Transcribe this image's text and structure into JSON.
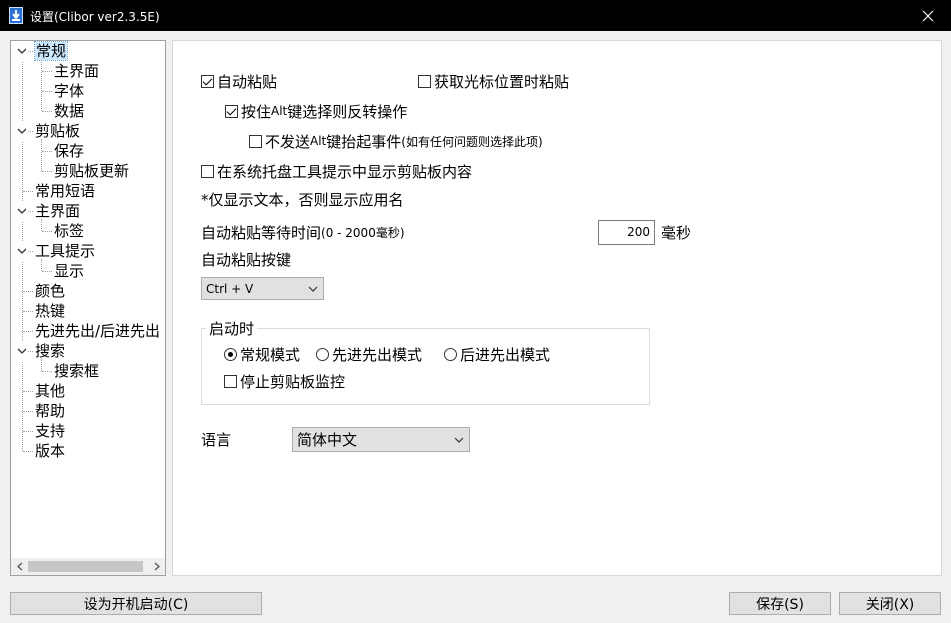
{
  "window": {
    "title": "设置(Clibor ver2.3.5E)"
  },
  "tree": {
    "items": [
      {
        "label": "常规",
        "level": 0,
        "expandable": true,
        "selected": true
      },
      {
        "label": "主界面",
        "level": 1
      },
      {
        "label": "字体",
        "level": 1
      },
      {
        "label": "数据",
        "level": 1
      },
      {
        "label": "剪贴板",
        "level": 0,
        "expandable": true
      },
      {
        "label": "保存",
        "level": 1
      },
      {
        "label": "剪贴板更新",
        "level": 1
      },
      {
        "label": "常用短语",
        "level": 0
      },
      {
        "label": "主界面",
        "level": 0,
        "expandable": true
      },
      {
        "label": "标签",
        "level": 1
      },
      {
        "label": "工具提示",
        "level": 0,
        "expandable": true
      },
      {
        "label": "显示",
        "level": 1
      },
      {
        "label": "颜色",
        "level": 0
      },
      {
        "label": "热键",
        "level": 0
      },
      {
        "label": "先进先出/后进先出",
        "level": 0
      },
      {
        "label": "搜索",
        "level": 0,
        "expandable": true
      },
      {
        "label": "搜索框",
        "level": 1
      },
      {
        "label": "其他",
        "level": 0
      },
      {
        "label": "帮助",
        "level": 0
      },
      {
        "label": "支持",
        "level": 0
      },
      {
        "label": "版本",
        "level": 0
      }
    ]
  },
  "general": {
    "auto_paste": {
      "label": "自动粘贴",
      "checked": true
    },
    "paste_on_cursor": {
      "label": "获取光标位置时粘贴",
      "checked": false
    },
    "alt_reverse": {
      "label_pre": "按住",
      "label_alt": "Alt",
      "label_post": "键选择则反转操作",
      "checked": true
    },
    "no_alt_up": {
      "label_pre": "不发送",
      "label_alt": "Alt",
      "label_mid": "键抬起事件",
      "label_post": "(如有任何问题则选择此项)",
      "checked": false
    },
    "tray_tooltip": {
      "label": "在系统托盘工具提示中显示剪贴板内容",
      "checked": false
    },
    "tray_note": "*仅显示文本，否则显示应用名",
    "wait_label": "自动粘贴等待时间",
    "wait_range": "(0 - 2000毫秒)",
    "wait_value": "200",
    "wait_unit": "毫秒",
    "paste_key_label": "自动粘贴按键",
    "paste_key_value": "Ctrl + V",
    "startup": {
      "title": "启动时",
      "modes": [
        {
          "label": "常规模式",
          "checked": true
        },
        {
          "label": "先进先出模式",
          "checked": false
        },
        {
          "label": "后进先出模式",
          "checked": false
        }
      ],
      "stop_monitor": {
        "label": "停止剪贴板监控",
        "checked": false
      }
    },
    "language_label": "语言",
    "language_value": "简体中文"
  },
  "buttons": {
    "startup": "设为开机启动(C)",
    "save": "保存(S)",
    "close": "关闭(X)"
  }
}
